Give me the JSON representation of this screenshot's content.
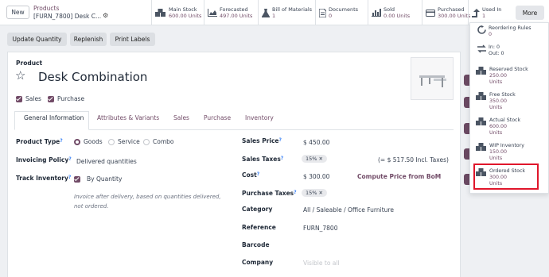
{
  "topbar": {
    "new_label": "New",
    "breadcrumb_parent": "Products",
    "breadcrumb_current": "[FURN_7800] Desk C...",
    "more_label": "More",
    "stats": [
      {
        "title": "Main Stock",
        "value": "600.00 Units",
        "icon": "boxes-icon"
      },
      {
        "title": "Forecasted",
        "value": "497.00 Units",
        "icon": "area-chart-icon"
      },
      {
        "title": "Bill of Materials",
        "value": "1",
        "icon": "flask-icon"
      },
      {
        "title": "Documents",
        "value": "0",
        "icon": "document-icon"
      },
      {
        "title": "Sold",
        "value": "0.00 Units",
        "icon": "bar-chart-icon"
      },
      {
        "title": "Purchased",
        "value": "300.00 Units",
        "icon": "credit-card-icon"
      },
      {
        "title": "Used In",
        "value": "1",
        "icon": "level-up-icon"
      }
    ]
  },
  "actions": {
    "update_quantity": "Update Quantity",
    "replenish": "Replenish",
    "print_labels": "Print Labels"
  },
  "product": {
    "label": "Product",
    "name": "Desk Combination",
    "sales_label": "Sales",
    "purchase_label": "Purchase"
  },
  "tabs": [
    "General Information",
    "Attributes & Variants",
    "Sales",
    "Purchase",
    "Inventory"
  ],
  "left_fields": {
    "product_type_label": "Product Type",
    "type_options": [
      "Goods",
      "Service",
      "Combo"
    ],
    "invoicing_policy_label": "Invoicing Policy",
    "invoicing_policy_value": "Delivered quantities",
    "track_inventory_label": "Track Inventory",
    "track_inventory_value": "By Quantity",
    "invoice_help": "Invoice after delivery, based on quantities delivered, not ordered."
  },
  "right_fields": {
    "sales_price_label": "Sales Price",
    "sales_price_value": "$ 450.00",
    "sales_taxes_label": "Sales Taxes",
    "sales_taxes_tag": "15%",
    "sales_taxes_incl": "(= $ 517.50 Incl. Taxes)",
    "cost_label": "Cost",
    "cost_value": "$ 300.00",
    "compute_price_label": "Compute Price from BoM",
    "purchase_taxes_label": "Purchase Taxes",
    "purchase_taxes_tag": "15%",
    "category_label": "Category",
    "category_value": "All / Saleable / Office Furniture",
    "reference_label": "Reference",
    "reference_value": "FURN_7800",
    "barcode_label": "Barcode",
    "company_label": "Company",
    "company_placeholder": "Visible to all"
  },
  "more_menu": [
    {
      "title": "Reordering Rules",
      "value": "0",
      "icon": "refresh-icon"
    },
    {
      "title": "In: 0",
      "value": "Out: 0",
      "icon": "exchange-icon"
    },
    {
      "title": "Reserved Stock",
      "value": "250.00",
      "unit": "Units",
      "icon": "boxes-icon"
    },
    {
      "title": "Free Stock",
      "value": "350.00",
      "unit": "Units",
      "icon": "boxes-icon"
    },
    {
      "title": "Actual Stock",
      "value": "600.00",
      "unit": "Units",
      "icon": "boxes-icon"
    },
    {
      "title": "WIP Inventory",
      "value": "150.00",
      "unit": "Units",
      "icon": "boxes-icon"
    },
    {
      "title": "Ordered Stock",
      "value": "300.00",
      "unit": "Units",
      "icon": "boxes-icon"
    }
  ],
  "colors": {
    "brand": "#714b67",
    "highlight": "#e0162b",
    "link": "#3b82f6"
  }
}
